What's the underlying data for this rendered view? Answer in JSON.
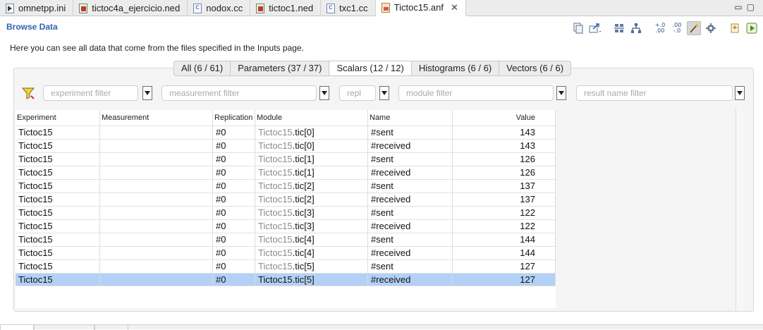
{
  "tabs": [
    {
      "label": "omnetpp.ini",
      "icon": "ini-file-icon",
      "active": false
    },
    {
      "label": "tictoc4a_ejercicio.ned",
      "icon": "ned-file-icon",
      "active": false
    },
    {
      "label": "nodox.cc",
      "icon": "cc-file-icon",
      "active": false
    },
    {
      "label": "tictoc1.ned",
      "icon": "ned-file-icon",
      "active": false
    },
    {
      "label": "txc1.cc",
      "icon": "cc-file-icon",
      "active": false
    },
    {
      "label": "Tictoc15.anf",
      "icon": "anf-file-icon",
      "active": true
    }
  ],
  "section_title": "Browse Data",
  "intro_text": "Here you can see all data that come from the files specified in the Inputs page.",
  "toolbar": {
    "zero_plus": "+.0",
    "zero_dot": ".00",
    "dot_zero": ".00",
    "minus_zero": "-.0"
  },
  "categories": [
    {
      "label": "All (6 / 61)",
      "active": false
    },
    {
      "label": "Parameters (37 / 37)",
      "active": false
    },
    {
      "label": "Scalars (12 / 12)",
      "active": true
    },
    {
      "label": "Histograms (6 / 6)",
      "active": false
    },
    {
      "label": "Vectors (6 / 6)",
      "active": false
    }
  ],
  "filters": {
    "experiment": "experiment filter",
    "measurement": "measurement filter",
    "replication": "repl",
    "module": "module filter",
    "result_name": "result name filter"
  },
  "table": {
    "columns": [
      "Experiment",
      "Measurement",
      "Replication",
      "Module",
      "Name",
      "Value"
    ],
    "rows": [
      {
        "experiment": "Tictoc15",
        "measurement": "",
        "replication": "#0",
        "module_prefix": "Tictoc15",
        "module_suffix": ".tic[0]",
        "name": "#sent",
        "value": "143"
      },
      {
        "experiment": "Tictoc15",
        "measurement": "",
        "replication": "#0",
        "module_prefix": "Tictoc15",
        "module_suffix": ".tic[0]",
        "name": "#received",
        "value": "143"
      },
      {
        "experiment": "Tictoc15",
        "measurement": "",
        "replication": "#0",
        "module_prefix": "Tictoc15",
        "module_suffix": ".tic[1]",
        "name": "#sent",
        "value": "126"
      },
      {
        "experiment": "Tictoc15",
        "measurement": "",
        "replication": "#0",
        "module_prefix": "Tictoc15",
        "module_suffix": ".tic[1]",
        "name": "#received",
        "value": "126"
      },
      {
        "experiment": "Tictoc15",
        "measurement": "",
        "replication": "#0",
        "module_prefix": "Tictoc15",
        "module_suffix": ".tic[2]",
        "name": "#sent",
        "value": "137"
      },
      {
        "experiment": "Tictoc15",
        "measurement": "",
        "replication": "#0",
        "module_prefix": "Tictoc15",
        "module_suffix": ".tic[2]",
        "name": "#received",
        "value": "137"
      },
      {
        "experiment": "Tictoc15",
        "measurement": "",
        "replication": "#0",
        "module_prefix": "Tictoc15",
        "module_suffix": ".tic[3]",
        "name": "#sent",
        "value": "122"
      },
      {
        "experiment": "Tictoc15",
        "measurement": "",
        "replication": "#0",
        "module_prefix": "Tictoc15",
        "module_suffix": ".tic[3]",
        "name": "#received",
        "value": "122"
      },
      {
        "experiment": "Tictoc15",
        "measurement": "",
        "replication": "#0",
        "module_prefix": "Tictoc15",
        "module_suffix": ".tic[4]",
        "name": "#sent",
        "value": "144"
      },
      {
        "experiment": "Tictoc15",
        "measurement": "",
        "replication": "#0",
        "module_prefix": "Tictoc15",
        "module_suffix": ".tic[4]",
        "name": "#received",
        "value": "144"
      },
      {
        "experiment": "Tictoc15",
        "measurement": "",
        "replication": "#0",
        "module_prefix": "Tictoc15",
        "module_suffix": ".tic[5]",
        "name": "#sent",
        "value": "127"
      },
      {
        "experiment": "Tictoc15",
        "measurement": "",
        "replication": "#0",
        "module_prefix": "Tictoc15",
        "module_suffix": ".tic[5]",
        "name": "#received",
        "value": "127",
        "selected": true
      }
    ]
  },
  "colors": {
    "accent": "#2b64b4",
    "selected_row": "#b3d1f6",
    "muted_text": "#8a8a8a"
  }
}
